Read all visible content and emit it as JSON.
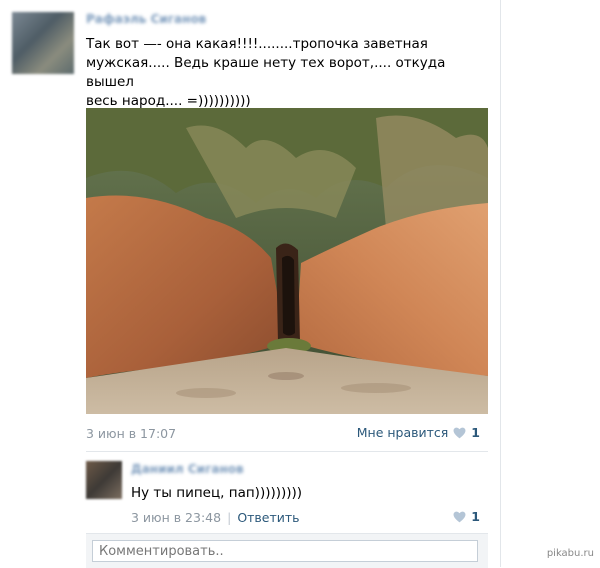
{
  "post": {
    "author": "Рафаэль Сиганов",
    "text": "Так вот —- она какая!!!!........тропочка заветная\nмужская..... Ведь краше нету тех ворот,.... откуда вышел\nвесь народ.... =))))))))))",
    "photo": "photo-of-eroded-gully-with-grass",
    "date": "3 июн в 17:07",
    "like_label": "Мне нравится",
    "like_count": "1"
  },
  "comment": {
    "author": "Даниил Сиганов",
    "text": "Ну ты пипец, пап)))))))))",
    "date": "3 июн в 23:48",
    "separator": "|",
    "reply_label": "Ответить",
    "like_count": "1"
  },
  "comment_box": {
    "placeholder": "Комментировать.."
  },
  "watermark": "pikabu.ru",
  "colors": {
    "link": "#2b587a",
    "muted": "#8c96a0",
    "heart": "#b4c5d6"
  },
  "icons": {
    "like": "heart-icon"
  }
}
